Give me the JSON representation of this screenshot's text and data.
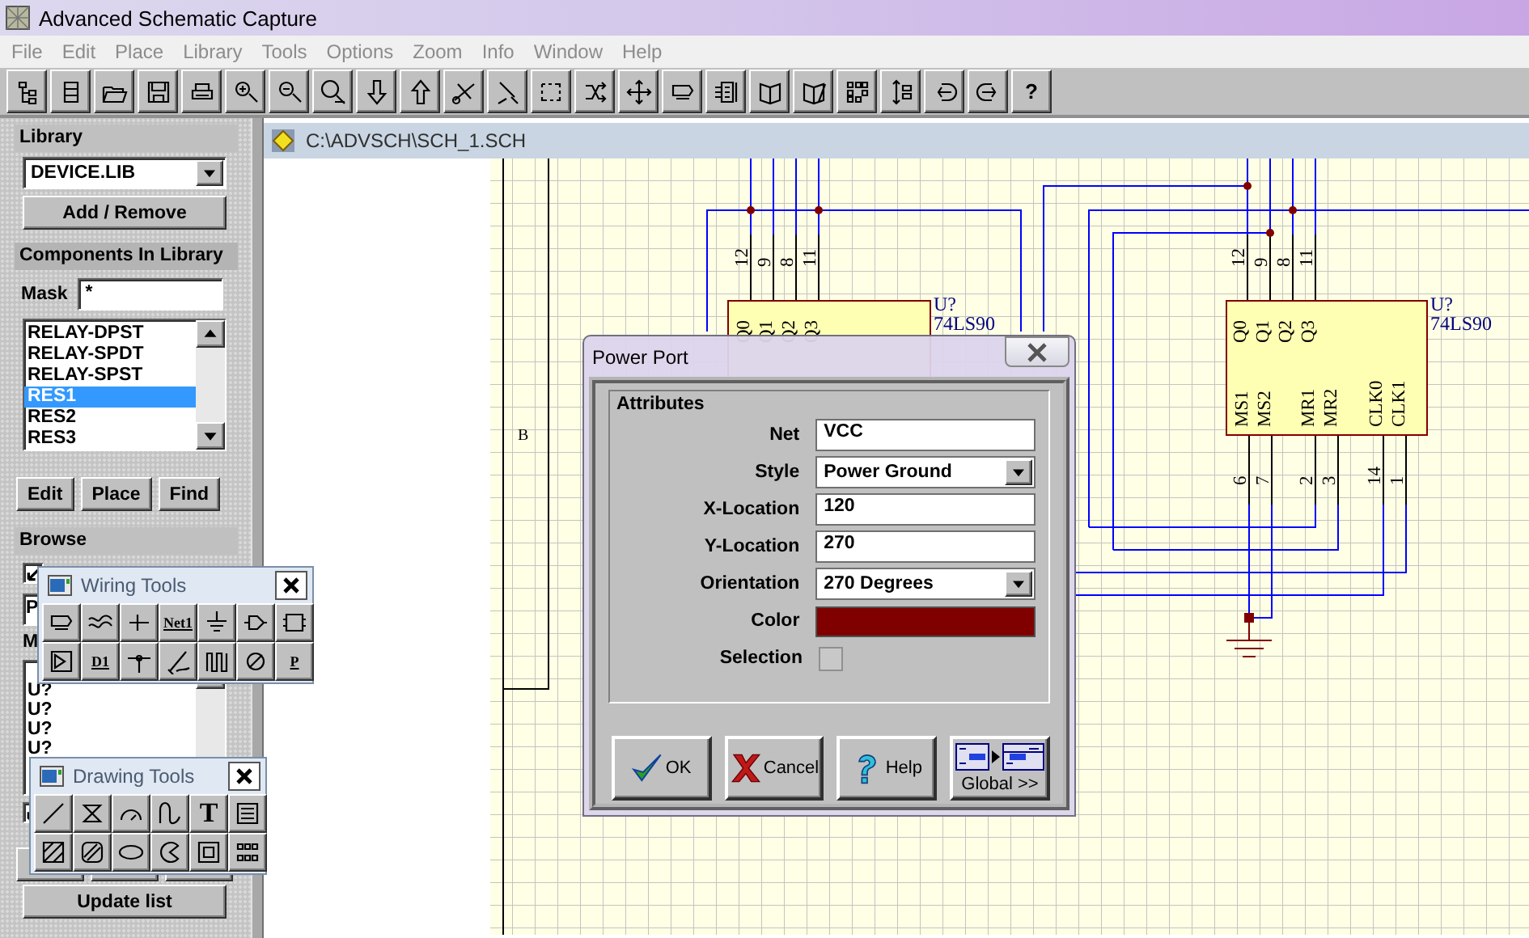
{
  "window": {
    "title": "Advanced Schematic Capture"
  },
  "menu": [
    "File",
    "Edit",
    "Place",
    "Library",
    "Tools",
    "Options",
    "Zoom",
    "Info",
    "Window",
    "Help"
  ],
  "toolbar": [
    {
      "kind": "tree"
    },
    {
      "kind": "sheet-stack"
    },
    {
      "kind": "folder"
    },
    {
      "kind": "floppy"
    },
    {
      "kind": "printer"
    },
    {
      "kind": "zoom-in"
    },
    {
      "kind": "zoom-out"
    },
    {
      "kind": "zoom-fit"
    },
    {
      "kind": "arrow-down"
    },
    {
      "kind": "arrow-up"
    },
    {
      "kind": "scissors"
    },
    {
      "kind": "probe"
    },
    {
      "kind": "select"
    },
    {
      "kind": "swap"
    },
    {
      "kind": "move"
    },
    {
      "kind": "bus"
    },
    {
      "kind": "pins"
    },
    {
      "kind": "book"
    },
    {
      "kind": "book-edit"
    },
    {
      "kind": "grid"
    },
    {
      "kind": "align"
    },
    {
      "kind": "undo"
    },
    {
      "kind": "redo"
    },
    {
      "kind": "text",
      "label": "?"
    }
  ],
  "library": {
    "heading": "Library",
    "file": "DEVICE.LIB",
    "add_button": "Add / Remove"
  },
  "components": {
    "heading": "Components In Library",
    "mask_label": "Mask",
    "mask_value": "*",
    "items": [
      {
        "label": "RELAY-DPST",
        "selected": false
      },
      {
        "label": "RELAY-SPDT",
        "selected": false
      },
      {
        "label": "RELAY-SPST",
        "selected": false
      },
      {
        "label": "RES1",
        "selected": true
      },
      {
        "label": "RES2",
        "selected": false
      },
      {
        "label": "RES3",
        "selected": false
      }
    ],
    "buttons": [
      "Edit",
      "Place",
      "Find"
    ]
  },
  "browse": {
    "heading": "Browse",
    "filter_checked": true,
    "type_value": "P",
    "mask_label": "M",
    "items": [
      "U?",
      "U?",
      "U?",
      "U?"
    ],
    "option_checked": true,
    "update_button": "Update list"
  },
  "document": {
    "title": "C:\\ADVSCH\\SCH_1.SCH",
    "zone_label": "B",
    "parts": [
      {
        "designator": "U?",
        "value": "74LS90",
        "top_pins": [
          {
            "name": "Q0",
            "number": "12"
          },
          {
            "name": "Q1",
            "number": "9"
          },
          {
            "name": "Q2",
            "number": "8"
          },
          {
            "name": "Q3",
            "number": "11"
          }
        ]
      },
      {
        "designator": "U?",
        "value": "74LS90",
        "top_pins": [
          {
            "name": "Q0",
            "number": "12"
          },
          {
            "name": "Q1",
            "number": "9"
          },
          {
            "name": "Q2",
            "number": "8"
          },
          {
            "name": "Q3",
            "number": "11"
          }
        ],
        "bottom_pins": [
          {
            "name": "MS1",
            "number": "6"
          },
          {
            "name": "MS2",
            "number": "7"
          },
          {
            "name": "MR1",
            "number": "2"
          },
          {
            "name": "MR2",
            "number": "3"
          },
          {
            "name": "CLK0",
            "number": "14"
          },
          {
            "name": "CLK1",
            "number": "1"
          }
        ]
      }
    ]
  },
  "wiring_tools": {
    "title": "Wiring Tools",
    "tools": [
      {
        "kind": "bus"
      },
      {
        "kind": "bus-entry"
      },
      {
        "kind": "wire"
      },
      {
        "kind": "text",
        "label": "Net1"
      },
      {
        "kind": "ground"
      },
      {
        "kind": "port"
      },
      {
        "kind": "sheet"
      },
      {
        "kind": "sheet-entry"
      },
      {
        "kind": "text",
        "label": "D1"
      },
      {
        "kind": "junction"
      },
      {
        "kind": "pen"
      },
      {
        "kind": "pulses"
      },
      {
        "kind": "no-connect"
      },
      {
        "kind": "text",
        "label": "P"
      }
    ]
  },
  "drawing_tools": {
    "title": "Drawing Tools",
    "tools": [
      {
        "kind": "line"
      },
      {
        "kind": "polygon"
      },
      {
        "kind": "arc"
      },
      {
        "kind": "curve"
      },
      {
        "kind": "text",
        "label": "T"
      },
      {
        "kind": "text-frame"
      },
      {
        "kind": "rectangle"
      },
      {
        "kind": "rounded-rectangle"
      },
      {
        "kind": "ellipse"
      },
      {
        "kind": "pie"
      },
      {
        "kind": "image"
      },
      {
        "kind": "array"
      }
    ]
  },
  "dialog": {
    "title": "Power Port",
    "group": "Attributes",
    "fields": [
      {
        "kind": "text",
        "label": "Net",
        "value": "VCC"
      },
      {
        "kind": "select",
        "label": "Style",
        "value": "Power Ground"
      },
      {
        "kind": "text",
        "label": "X-Location",
        "value": "120"
      },
      {
        "kind": "text",
        "label": "Y-Location",
        "value": "270"
      },
      {
        "kind": "select",
        "label": "Orientation",
        "value": "270 Degrees"
      },
      {
        "kind": "color",
        "label": "Color",
        "color": "#800000"
      },
      {
        "kind": "checkbox",
        "label": "Selection",
        "checked": false
      }
    ],
    "buttons": [
      {
        "kind": "ok",
        "label": "OK"
      },
      {
        "kind": "cancel",
        "label": "Cancel"
      },
      {
        "kind": "help",
        "label": "Help"
      },
      {
        "kind": "global",
        "label": "Global >>"
      }
    ]
  }
}
